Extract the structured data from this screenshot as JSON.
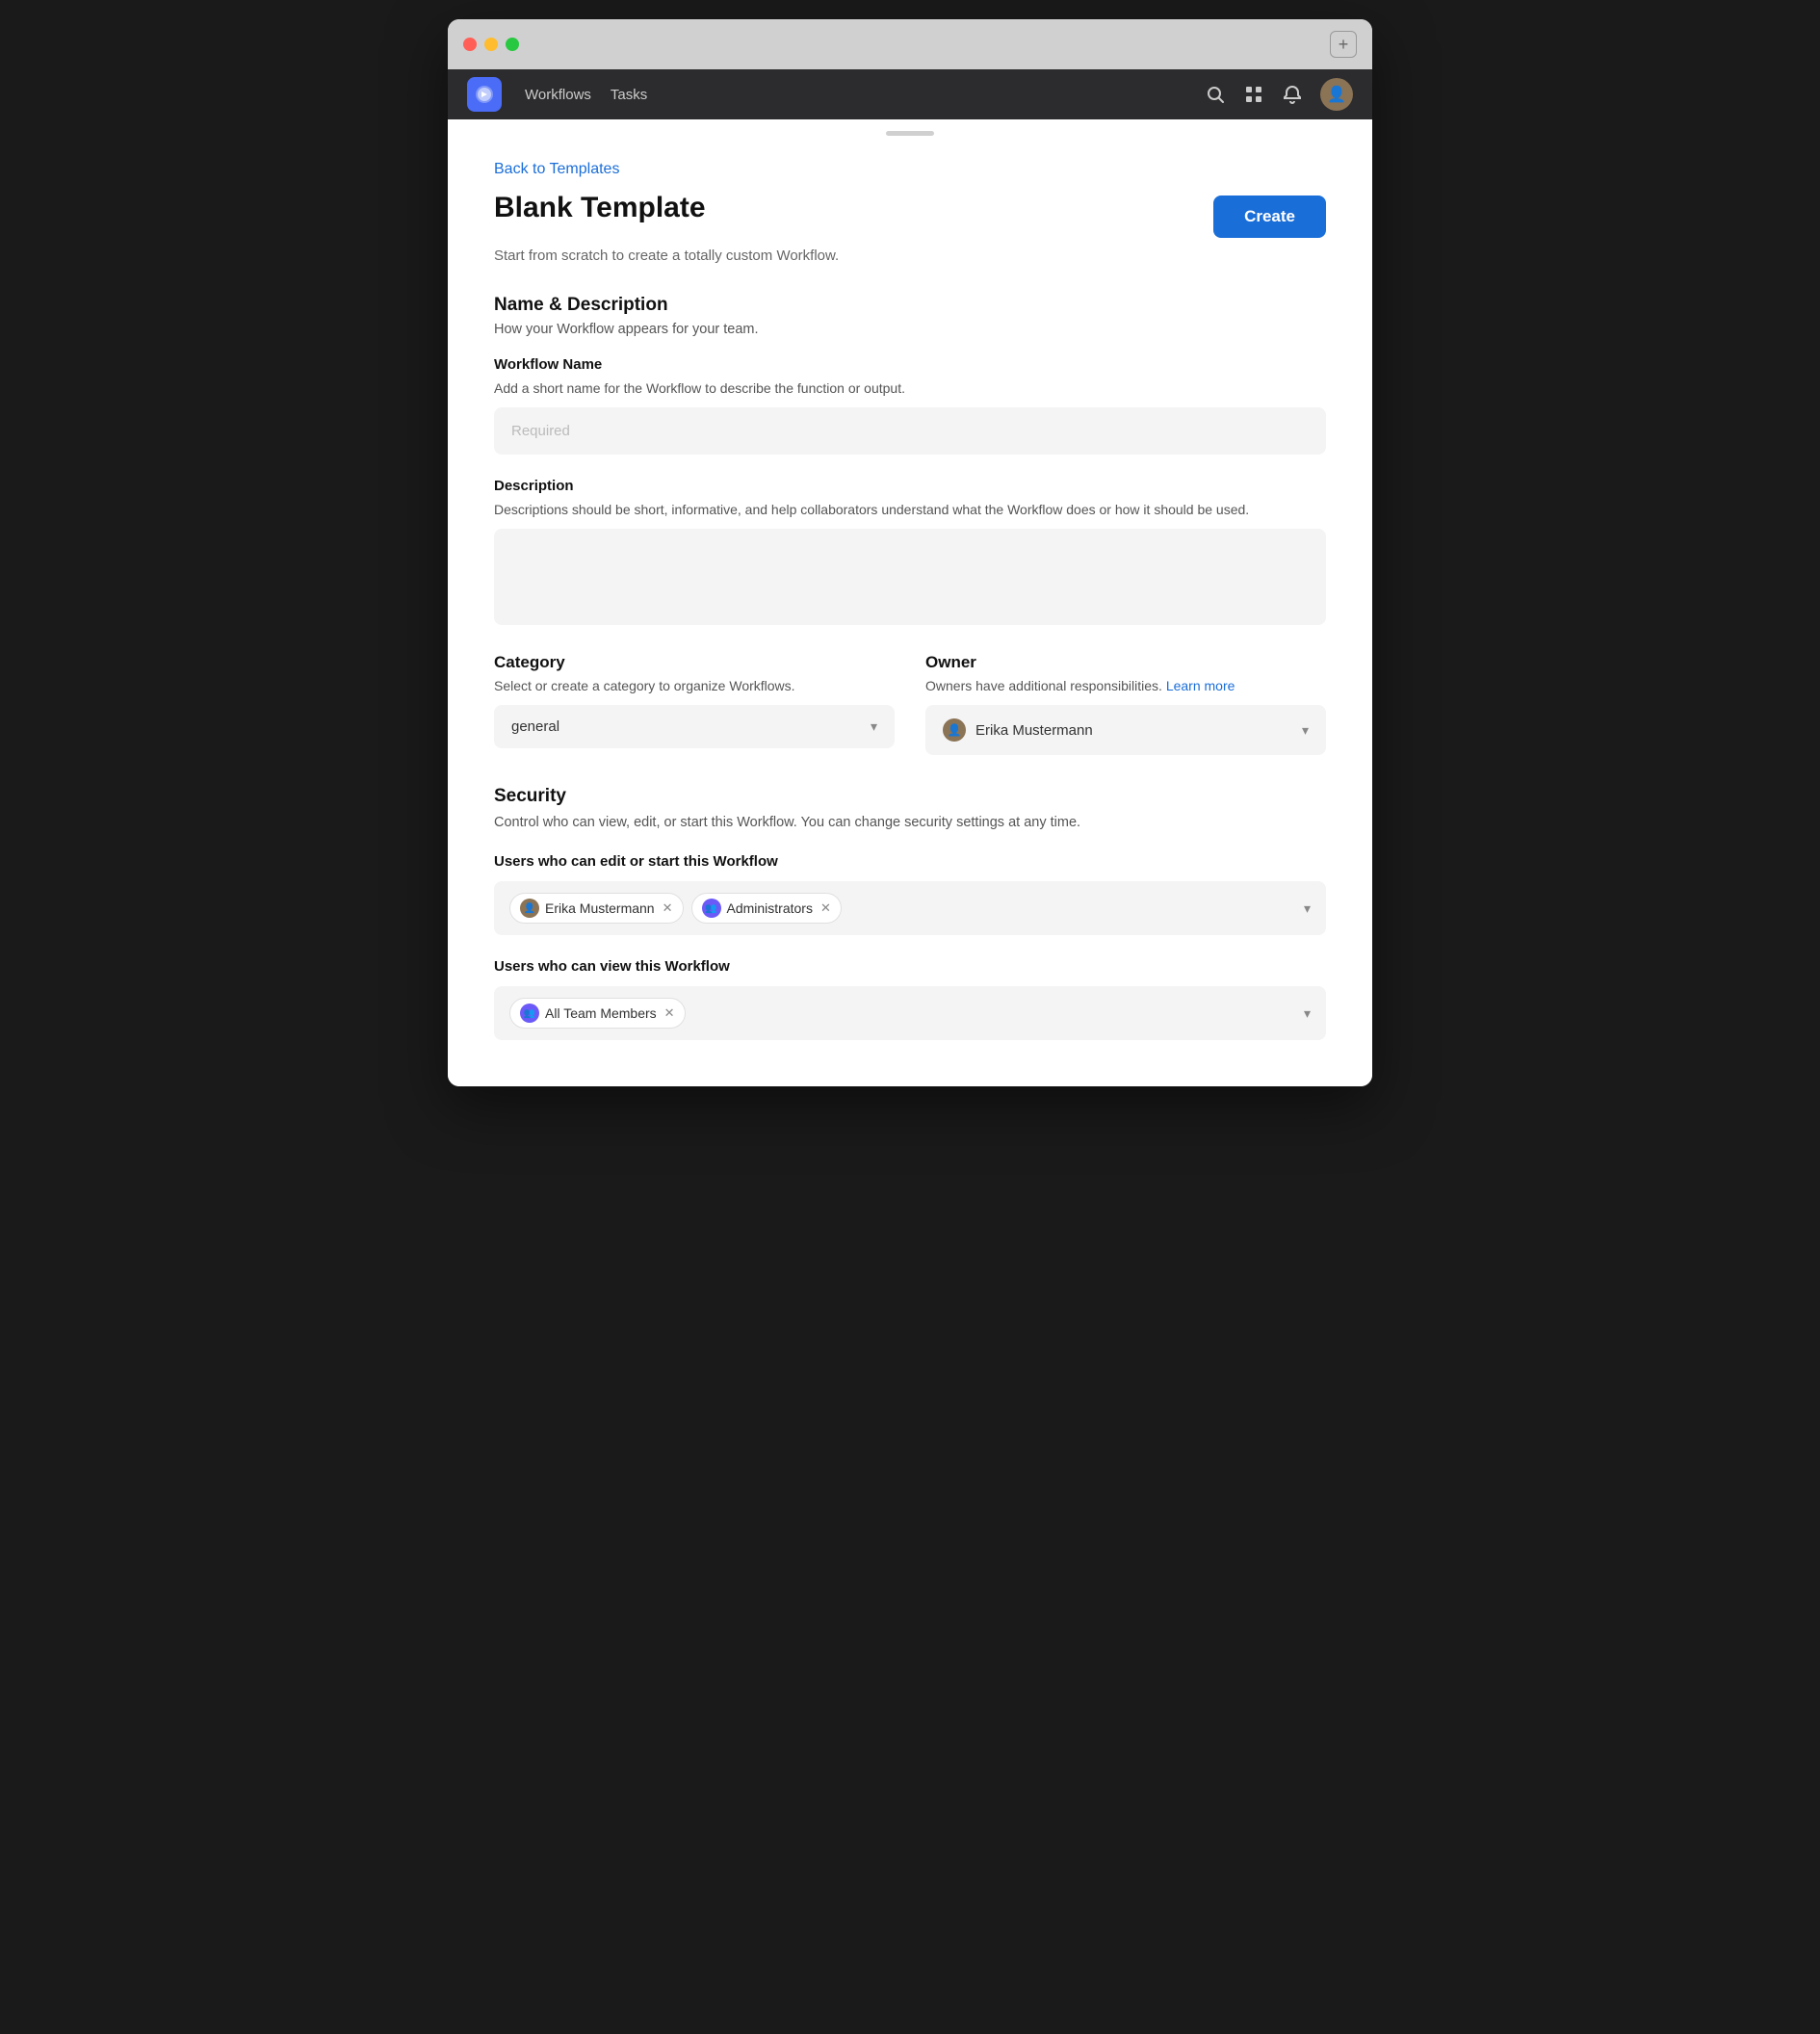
{
  "window": {
    "traffic_lights": [
      "red",
      "yellow",
      "green"
    ]
  },
  "nav": {
    "logo": "🔷",
    "links": [
      "Workflows",
      "Tasks"
    ],
    "plus_label": "+"
  },
  "modal": {
    "handle": true,
    "back_link": "Back to Templates",
    "title": "Blank Template",
    "subtitle": "Start from scratch to create a totally custom Workflow.",
    "create_button": "Create"
  },
  "name_description": {
    "section_title": "Name & Description",
    "section_desc": "How your Workflow appears for your team.",
    "workflow_name_label": "Workflow Name",
    "workflow_name_desc": "Add a short name for the Workflow to describe the function or output.",
    "workflow_name_placeholder": "Required",
    "description_label": "Description",
    "description_desc": "Descriptions should be short, informative, and help collaborators understand what the Workflow does or how it should be used.",
    "description_placeholder": ""
  },
  "category": {
    "label": "Category",
    "desc": "Select or create a category to organize Workflows.",
    "value": "general"
  },
  "owner": {
    "label": "Owner",
    "desc": "Owners have additional responsibilities.",
    "learn_more": "Learn more",
    "value": "Erika Mustermann"
  },
  "security": {
    "section_title": "Security",
    "section_desc": "Control who can view, edit, or start this Workflow. You can change security settings at any time.",
    "edit_start_label": "Users who can edit or start this Workflow",
    "edit_start_users": [
      {
        "name": "Erika Mustermann",
        "type": "person"
      },
      {
        "name": "Administrators",
        "type": "group"
      }
    ],
    "view_label": "Users who can view this Workflow",
    "view_users": [
      {
        "name": "All Team Members",
        "type": "group"
      }
    ]
  }
}
